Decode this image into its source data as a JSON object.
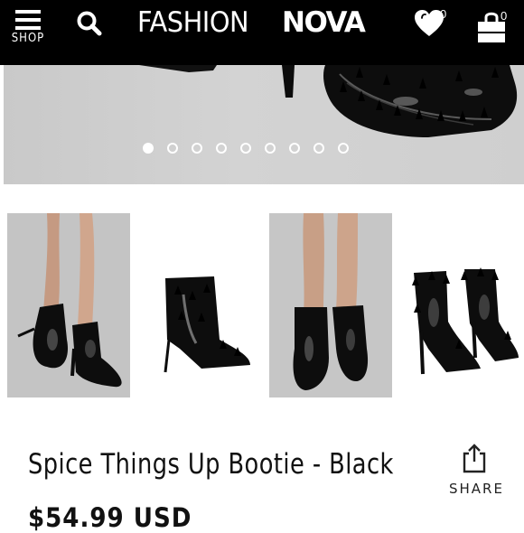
{
  "header": {
    "menu_label": "SHOP",
    "logo_light": "FASHION",
    "logo_bold": "NOVA",
    "wishlist_count": "0",
    "cart_count": "0",
    "icons": [
      "menu-icon",
      "search-icon",
      "heart-icon",
      "shopping-bag-icon"
    ]
  },
  "gallery": {
    "dot_count": 9,
    "active_dot": 1
  },
  "product": {
    "title": "Spice Things Up Bootie - Black",
    "price": "$54.99 USD",
    "share_label": "SHARE"
  },
  "colors": {
    "header_bg": "#000000",
    "hero_bg": "#cfcfcf",
    "text": "#111111"
  }
}
